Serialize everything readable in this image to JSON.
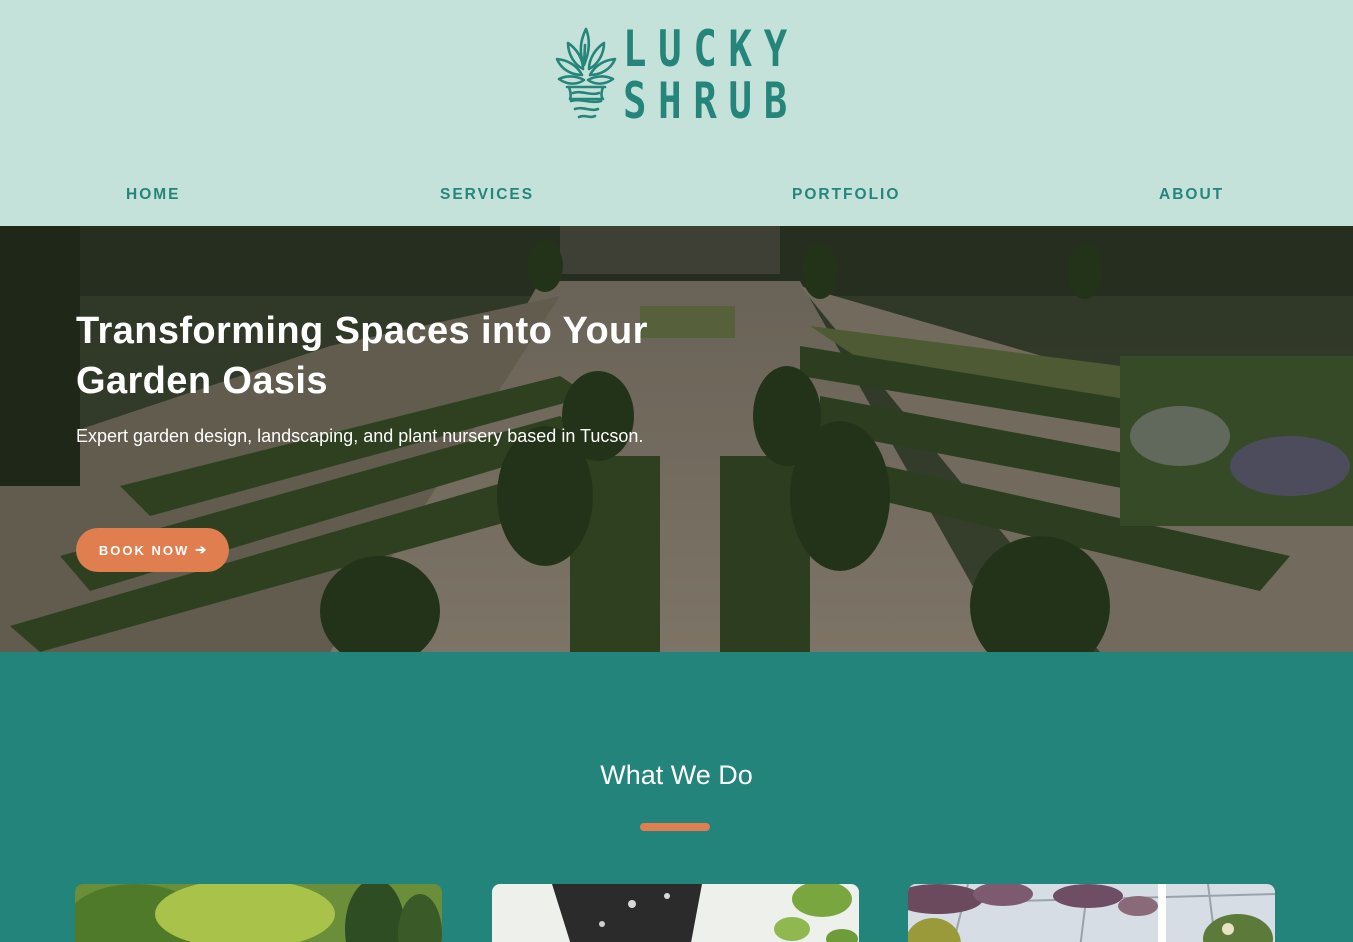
{
  "brand": {
    "name_line1": "LUCKY",
    "name_line2": "SHRUB",
    "logo_icon": "potted-plant-icon",
    "color": "#25857A"
  },
  "nav": {
    "items": [
      {
        "label": "HOME"
      },
      {
        "label": "SERVICES"
      },
      {
        "label": "PORTFOLIO"
      },
      {
        "label": "ABOUT"
      }
    ]
  },
  "hero": {
    "title": "Transforming Spaces into Your Garden Oasis",
    "subtitle": "Expert garden design, landscaping, and plant nursery based in Tucson.",
    "button_label": "BOOK NOW",
    "button_icon": "arrow-right-icon",
    "button_icon_glyph": "➔",
    "background_image": "formal-garden-photo"
  },
  "services": {
    "title": "What We Do",
    "cards": [
      {
        "image": "garden-trees-photo"
      },
      {
        "image": "potted-plant-photo"
      },
      {
        "image": "greenhouse-hanging-baskets-photo"
      }
    ]
  },
  "colors": {
    "header_bg": "#C5E2DA",
    "teal": "#22847A",
    "accent": "#E07E50",
    "text_light": "#FFFFFF"
  }
}
